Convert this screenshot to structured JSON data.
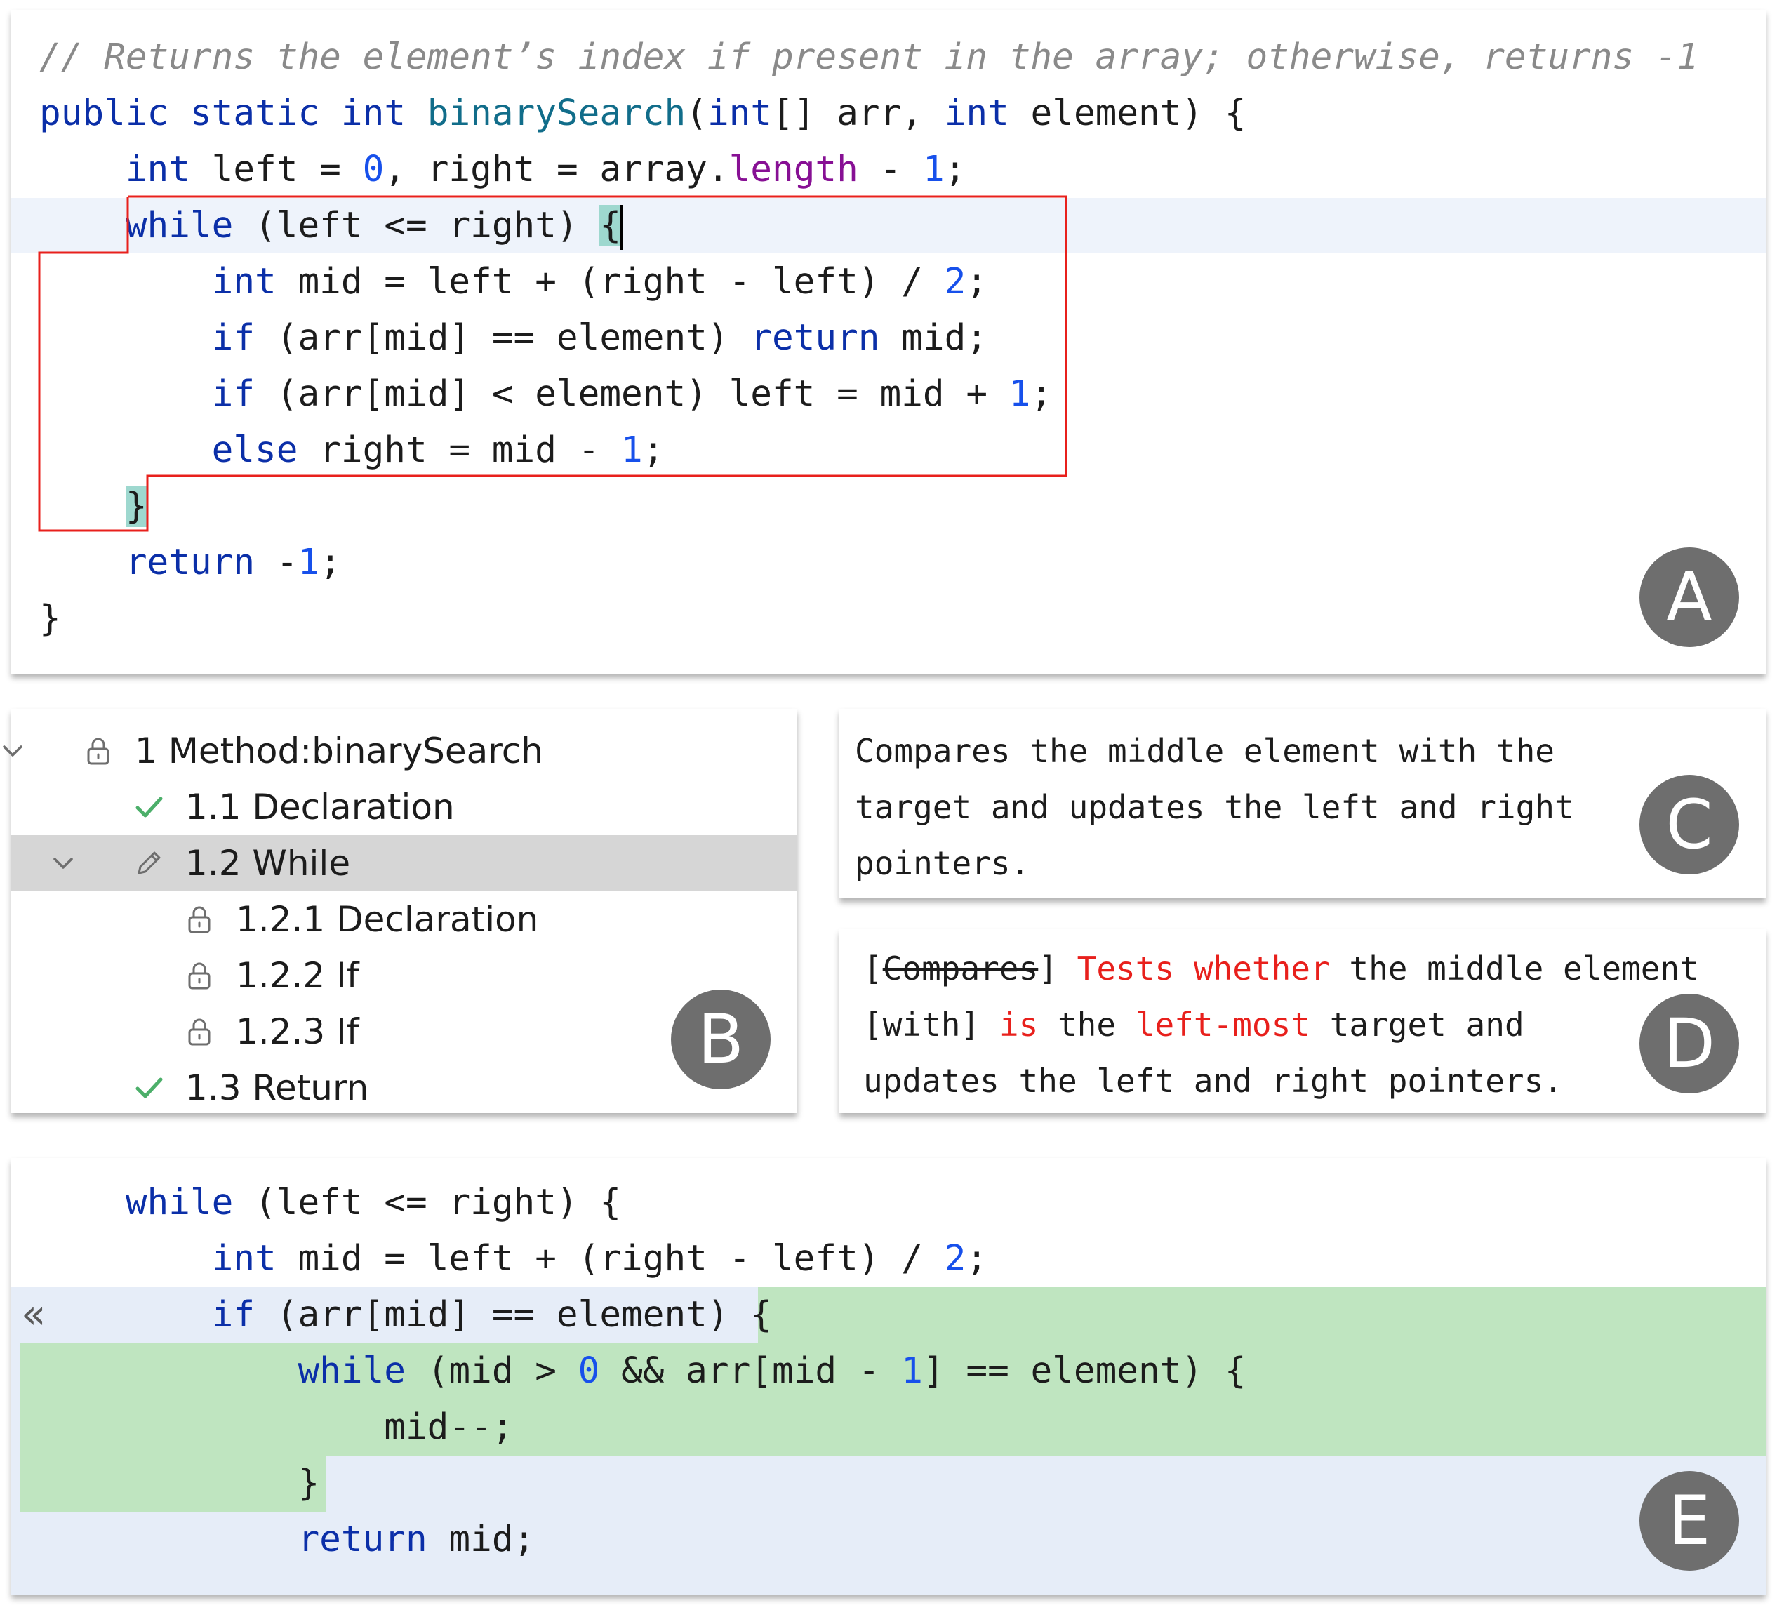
{
  "editor": {
    "badge": "A",
    "lines": [
      [
        {
          "t": "// Returns the element’s index if present in the array; otherwise, returns -1",
          "c": "cmt"
        }
      ],
      [
        {
          "t": "public",
          "c": "kw"
        },
        {
          "t": " "
        },
        {
          "t": "static",
          "c": "kw"
        },
        {
          "t": " "
        },
        {
          "t": "int",
          "c": "kw"
        },
        {
          "t": " "
        },
        {
          "t": "binarySearch",
          "c": "fn"
        },
        {
          "t": "("
        },
        {
          "t": "int",
          "c": "kw"
        },
        {
          "t": "[] arr, "
        },
        {
          "t": "int",
          "c": "kw"
        },
        {
          "t": " element) {"
        }
      ],
      [
        {
          "t": "    "
        },
        {
          "t": "int",
          "c": "kw"
        },
        {
          "t": " left = "
        },
        {
          "t": "0",
          "c": "num"
        },
        {
          "t": ", right = array."
        },
        {
          "t": "length",
          "c": "fld"
        },
        {
          "t": " - "
        },
        {
          "t": "1",
          "c": "num"
        },
        {
          "t": ";"
        }
      ],
      [
        {
          "t": "    "
        },
        {
          "t": "while",
          "c": "kw"
        },
        {
          "t": " (left <= right) "
        },
        {
          "t": "{",
          "c": "bm"
        },
        {
          "t": "",
          "c": "caret"
        }
      ],
      [
        {
          "t": "        "
        },
        {
          "t": "int",
          "c": "kw"
        },
        {
          "t": " mid = left + (right - left) / "
        },
        {
          "t": "2",
          "c": "num"
        },
        {
          "t": ";"
        }
      ],
      [
        {
          "t": "        "
        },
        {
          "t": "if",
          "c": "kw"
        },
        {
          "t": " (arr[mid] == element) "
        },
        {
          "t": "return",
          "c": "kw"
        },
        {
          "t": " mid;"
        }
      ],
      [
        {
          "t": "        "
        },
        {
          "t": "if",
          "c": "kw"
        },
        {
          "t": " (arr[mid] < element) left = mid + "
        },
        {
          "t": "1",
          "c": "num"
        },
        {
          "t": ";"
        }
      ],
      [
        {
          "t": "        "
        },
        {
          "t": "else",
          "c": "kw"
        },
        {
          "t": " right = mid - "
        },
        {
          "t": "1",
          "c": "num"
        },
        {
          "t": ";"
        }
      ],
      [
        {
          "t": "    "
        },
        {
          "t": "}",
          "c": "bm"
        }
      ],
      [
        {
          "t": "    "
        },
        {
          "t": "return",
          "c": "kw"
        },
        {
          "t": " -"
        },
        {
          "t": "1",
          "c": "num"
        },
        {
          "t": ";"
        }
      ],
      [
        {
          "t": "}"
        }
      ]
    ]
  },
  "outline": {
    "badge": "B",
    "items": [
      {
        "label": "1 Method:binarySearch",
        "icon": "lock-icon",
        "chevron": true,
        "indent": 0
      },
      {
        "label": "1.1 Declaration",
        "icon": "check-icon",
        "chevron": false,
        "indent": 1
      },
      {
        "label": "1.2 While",
        "icon": "pencil-icon",
        "chevron": true,
        "indent": 1,
        "selected": true
      },
      {
        "label": "1.2.1 Declaration",
        "icon": "lock-icon",
        "chevron": false,
        "indent": 2
      },
      {
        "label": "1.2.2 If",
        "icon": "lock-icon",
        "chevron": false,
        "indent": 2
      },
      {
        "label": "1.2.3 If",
        "icon": "lock-icon",
        "chevron": false,
        "indent": 2
      },
      {
        "label": "1.3 Return",
        "icon": "check-icon",
        "chevron": false,
        "indent": 1
      }
    ]
  },
  "summary": {
    "badge": "C",
    "lines": [
      "Compares the middle element with the",
      "target and updates the left and right",
      "pointers."
    ]
  },
  "edited_summary": {
    "badge": "D",
    "lines": [
      [
        {
          "t": "["
        },
        {
          "t": "Compares",
          "c": "strike"
        },
        {
          "t": "] "
        },
        {
          "t": "Tests whether",
          "c": "red"
        },
        {
          "t": " the middle element"
        }
      ],
      [
        {
          "t": "[with] "
        },
        {
          "t": "is",
          "c": "red"
        },
        {
          "t": " the "
        },
        {
          "t": "left-most",
          "c": "red"
        },
        {
          "t": " target and"
        }
      ],
      [
        {
          "t": "updates the left and right pointers."
        }
      ]
    ]
  },
  "diff": {
    "badge": "E",
    "revert_glyph": "«",
    "lines": [
      [
        {
          "t": "    "
        },
        {
          "t": "while",
          "c": "kw"
        },
        {
          "t": " (left <= right) {"
        }
      ],
      [
        {
          "t": "        "
        },
        {
          "t": "int",
          "c": "kw"
        },
        {
          "t": " mid = left + (right - left) / "
        },
        {
          "t": "2",
          "c": "num"
        },
        {
          "t": ";"
        }
      ],
      [
        {
          "t": "        "
        },
        {
          "t": "if",
          "c": "kw"
        },
        {
          "t": " (arr[mid] == element) {"
        }
      ],
      [
        {
          "t": "            "
        },
        {
          "t": "while",
          "c": "kw"
        },
        {
          "t": " (mid > "
        },
        {
          "t": "0",
          "c": "num"
        },
        {
          "t": " && arr[mid - "
        },
        {
          "t": "1",
          "c": "num"
        },
        {
          "t": "] == element) {"
        }
      ],
      [
        {
          "t": "                mid--;"
        }
      ],
      [
        {
          "t": "            }"
        }
      ],
      [
        {
          "t": "            "
        },
        {
          "t": "return",
          "c": "kw"
        },
        {
          "t": " mid;"
        }
      ]
    ]
  },
  "colors": {
    "keyword": "#0b2fa8",
    "function": "#116d8a",
    "number": "#1750eb",
    "field": "#871094",
    "comment": "#8a8a8a",
    "bracket_match": "#9ed8cf",
    "selection_box": "#e8201c",
    "diff_added": "#bfe5c0",
    "diff_context": "#e6edf8",
    "current_line": "#eef3fb",
    "tree_selected": "#d6d6d6",
    "check": "#4caf6a",
    "badge": "#6e6e6e",
    "edit_red": "#e8201c"
  }
}
